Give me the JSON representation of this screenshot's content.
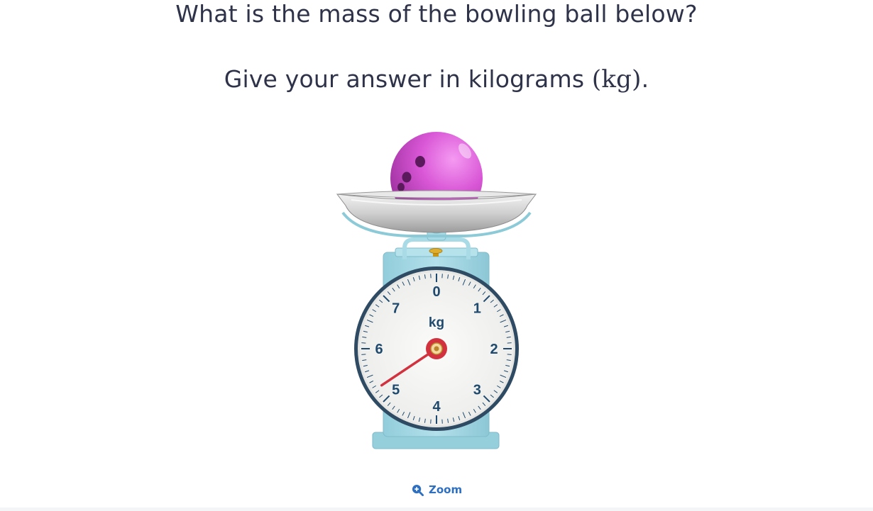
{
  "question": {
    "line1": "What is the mass of the bowling ball below?",
    "line2_prefix": "Give your answer in kilograms ",
    "line2_unit": "(kg)",
    "line2_suffix": "."
  },
  "scale": {
    "unit_label": "kg",
    "dial_numbers": [
      "0",
      "1",
      "2",
      "3",
      "4",
      "5",
      "6",
      "7"
    ],
    "needle_reading_kg": 5.25,
    "dial_max_kg": 8,
    "ticks_per_kg": 10
  },
  "zoom": {
    "label": "Zoom",
    "icon": "magnifier-plus-icon"
  },
  "colors": {
    "text": "#2f3349",
    "link": "#2f6fc0",
    "ball": "#d957d6",
    "scale_body": "#a9dbe6",
    "needle": "#d2313e",
    "dial_text": "#1f4a6e"
  }
}
